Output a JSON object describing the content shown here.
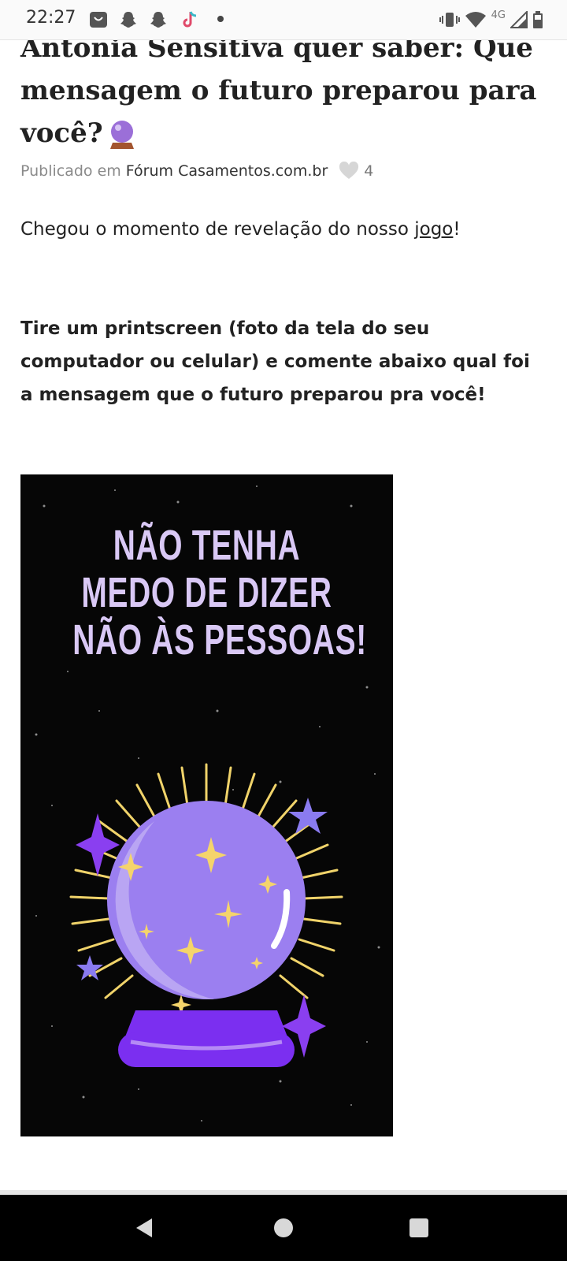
{
  "status_bar": {
    "time": "22:27",
    "network": "4G",
    "icons": [
      "app-notification-icon",
      "snapchat-icon",
      "snapchat-icon",
      "tiktok-icon",
      "more-notifications-dot",
      "vibrate-icon",
      "wifi-icon",
      "signal-icon",
      "battery-icon"
    ]
  },
  "article": {
    "title": "Antonia Sensitiva quer saber: Que mensagem o futuro preparou para você?",
    "title_emoji": "crystal-ball-icon",
    "meta": {
      "published_prefix": "Publicado em",
      "forum_name": "Fórum Casamentos.com.br",
      "likes": "4"
    },
    "intro_before_link": "Chegou o momento de revelação do nosso ",
    "intro_link": "jogo",
    "intro_after_link": "!",
    "instructions": "Tire um printscreen (foto da tela do seu computador ou celular) e comente abaixo qual foi a mensagem que o futuro preparou pra você!",
    "image": {
      "lines": [
        "NÃO TENHA",
        "MEDO DE DIZER",
        "NÃO ÀS PESSOAS!"
      ],
      "colors": {
        "background": "#060606",
        "text": "#d9c8f5",
        "ball": "#9b7ff0",
        "base": "#7b2ff0",
        "rays": "#f0d36a"
      }
    }
  },
  "nav_bar": {
    "buttons": [
      "back-icon",
      "home-icon",
      "recents-icon"
    ]
  }
}
